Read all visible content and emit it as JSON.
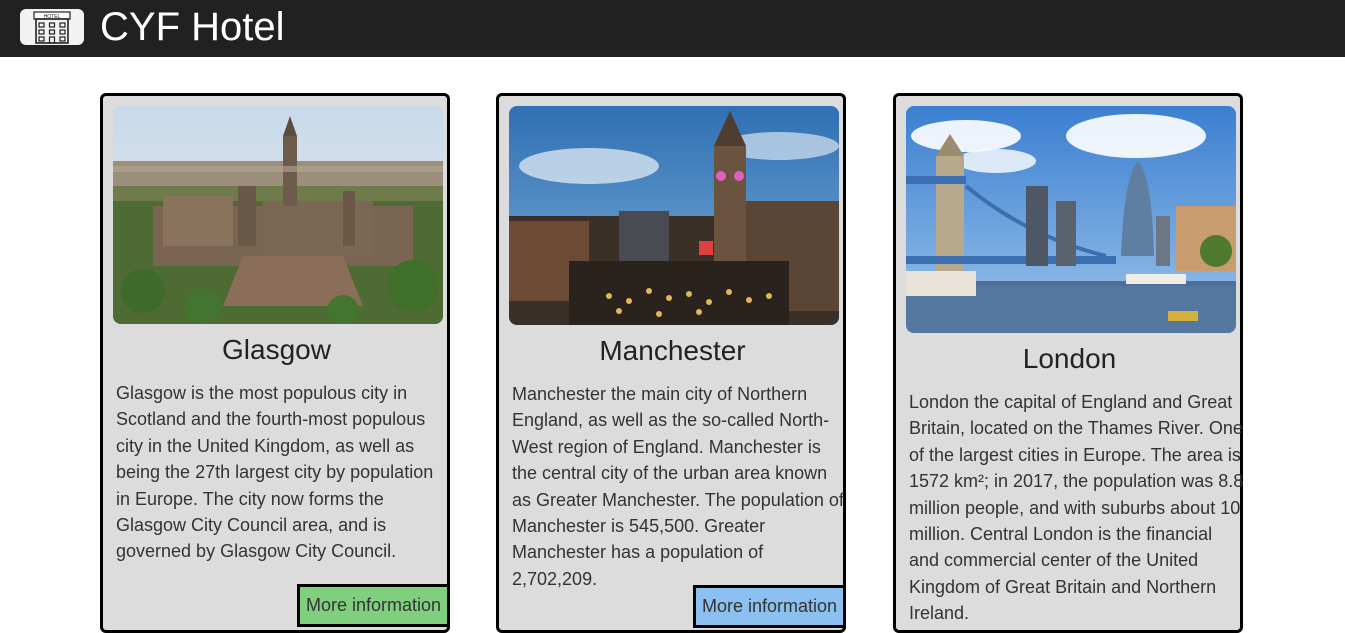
{
  "header": {
    "brand": "CYF Hotel",
    "logo_text": "HOTEL",
    "logo_icon": "hotel-building-icon",
    "background": "#212121"
  },
  "cards": [
    {
      "title": "Glasgow",
      "image_alt": "Glasgow aerial view",
      "description": "Glasgow is the most populous city in Scotland and the fourth-most populous city in the United Kingdom, as well as being the 27th largest city by population in Europe. The city now forms the Glasgow City Council area, and is governed by Glasgow City Council.",
      "button_label": "More information",
      "button_color": "#7fcf7f"
    },
    {
      "title": "Manchester",
      "image_alt": "Manchester town hall at night",
      "description": "Manchester the main city of Northern England, as well as the so-called North-West region of England. Manchester is the central city of the urban area known as Greater Manchester. The population of Manchester is 545,500. Greater Manchester has a population of 2,702,209.",
      "button_label": "More information",
      "button_color": "#8cc0f0"
    },
    {
      "title": "London",
      "image_alt": "London Tower Bridge and skyline",
      "description": "London the capital of England and Great Britain, located on the Thames River. One of the largest cities in Europe. The area is 1572 km²; in 2017, the population was 8.8 million people, and with suburbs about 10 million. Central London is the financial and commercial center of the United Kingdom of Great Britain and Northern Ireland.",
      "button_label": "",
      "button_color": ""
    }
  ]
}
